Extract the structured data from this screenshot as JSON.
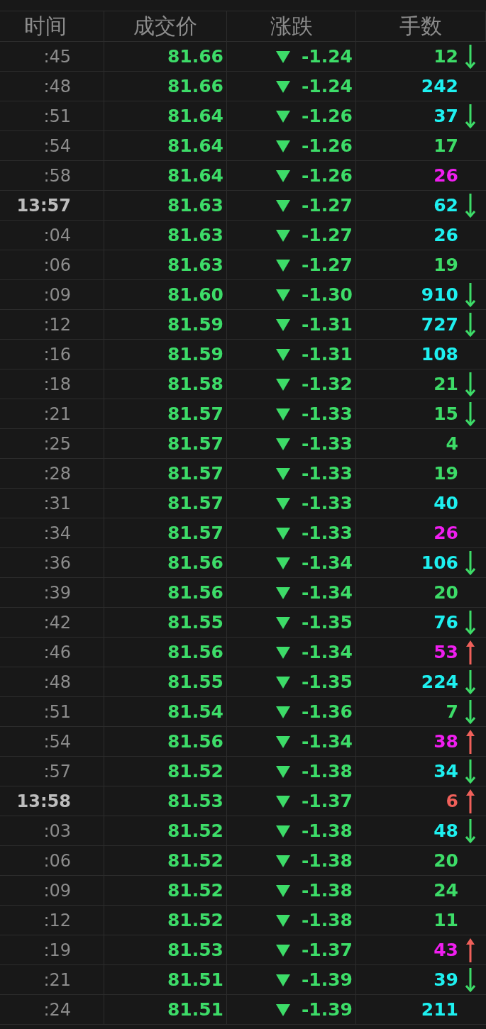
{
  "columns": [
    "时间",
    "成交价",
    "涨跌",
    "手数"
  ],
  "rows": [
    {
      "time": ":45",
      "bold": false,
      "price": "81.66",
      "falling": true,
      "change": "-1.24",
      "volume": "12",
      "color": "#3ddc68",
      "arrow_down": true,
      "arrow_up": false
    },
    {
      "time": ":48",
      "bold": false,
      "price": "81.66",
      "falling": true,
      "change": "-1.24",
      "volume": "242",
      "color": "#1ef0f0",
      "arrow_down": false,
      "arrow_up": false
    },
    {
      "time": ":51",
      "bold": false,
      "price": "81.64",
      "falling": true,
      "change": "-1.26",
      "volume": "37",
      "color": "#1ef0f0",
      "arrow_down": true,
      "arrow_up": false
    },
    {
      "time": ":54",
      "bold": false,
      "price": "81.64",
      "falling": true,
      "change": "-1.26",
      "volume": "17",
      "color": "#3ddc68",
      "arrow_down": false,
      "arrow_up": false
    },
    {
      "time": ":58",
      "bold": false,
      "price": "81.64",
      "falling": true,
      "change": "-1.26",
      "volume": "26",
      "color": "#f01ef0",
      "arrow_down": false,
      "arrow_up": false
    },
    {
      "time": "13:57",
      "bold": true,
      "price": "81.63",
      "falling": true,
      "change": "-1.27",
      "volume": "62",
      "color": "#1ef0f0",
      "arrow_down": true,
      "arrow_up": false
    },
    {
      "time": ":04",
      "bold": false,
      "price": "81.63",
      "falling": true,
      "change": "-1.27",
      "volume": "26",
      "color": "#1ef0f0",
      "arrow_down": false,
      "arrow_up": false
    },
    {
      "time": ":06",
      "bold": false,
      "price": "81.63",
      "falling": true,
      "change": "-1.27",
      "volume": "19",
      "color": "#3ddc68",
      "arrow_down": false,
      "arrow_up": false
    },
    {
      "time": ":09",
      "bold": false,
      "price": "81.60",
      "falling": true,
      "change": "-1.30",
      "volume": "910",
      "color": "#1ef0f0",
      "arrow_down": true,
      "arrow_up": false
    },
    {
      "time": ":12",
      "bold": false,
      "price": "81.59",
      "falling": true,
      "change": "-1.31",
      "volume": "727",
      "color": "#1ef0f0",
      "arrow_down": true,
      "arrow_up": false
    },
    {
      "time": ":16",
      "bold": false,
      "price": "81.59",
      "falling": true,
      "change": "-1.31",
      "volume": "108",
      "color": "#1ef0f0",
      "arrow_down": false,
      "arrow_up": false
    },
    {
      "time": ":18",
      "bold": false,
      "price": "81.58",
      "falling": true,
      "change": "-1.32",
      "volume": "21",
      "color": "#3ddc68",
      "arrow_down": true,
      "arrow_up": false
    },
    {
      "time": ":21",
      "bold": false,
      "price": "81.57",
      "falling": true,
      "change": "-1.33",
      "volume": "15",
      "color": "#3ddc68",
      "arrow_down": true,
      "arrow_up": false
    },
    {
      "time": ":25",
      "bold": false,
      "price": "81.57",
      "falling": true,
      "change": "-1.33",
      "volume": "4",
      "color": "#3ddc68",
      "arrow_down": false,
      "arrow_up": false
    },
    {
      "time": ":28",
      "bold": false,
      "price": "81.57",
      "falling": true,
      "change": "-1.33",
      "volume": "19",
      "color": "#3ddc68",
      "arrow_down": false,
      "arrow_up": false
    },
    {
      "time": ":31",
      "bold": false,
      "price": "81.57",
      "falling": true,
      "change": "-1.33",
      "volume": "40",
      "color": "#1ef0f0",
      "arrow_down": false,
      "arrow_up": false
    },
    {
      "time": ":34",
      "bold": false,
      "price": "81.57",
      "falling": true,
      "change": "-1.33",
      "volume": "26",
      "color": "#f01ef0",
      "arrow_down": false,
      "arrow_up": false
    },
    {
      "time": ":36",
      "bold": false,
      "price": "81.56",
      "falling": true,
      "change": "-1.34",
      "volume": "106",
      "color": "#1ef0f0",
      "arrow_down": true,
      "arrow_up": false
    },
    {
      "time": ":39",
      "bold": false,
      "price": "81.56",
      "falling": true,
      "change": "-1.34",
      "volume": "20",
      "color": "#3ddc68",
      "arrow_down": false,
      "arrow_up": false
    },
    {
      "time": ":42",
      "bold": false,
      "price": "81.55",
      "falling": true,
      "change": "-1.35",
      "volume": "76",
      "color": "#1ef0f0",
      "arrow_down": true,
      "arrow_up": false
    },
    {
      "time": ":46",
      "bold": false,
      "price": "81.56",
      "falling": true,
      "change": "-1.34",
      "volume": "53",
      "color": "#f01ef0",
      "arrow_down": false,
      "arrow_up": true
    },
    {
      "time": ":48",
      "bold": false,
      "price": "81.55",
      "falling": true,
      "change": "-1.35",
      "volume": "224",
      "color": "#1ef0f0",
      "arrow_down": true,
      "arrow_up": false
    },
    {
      "time": ":51",
      "bold": false,
      "price": "81.54",
      "falling": true,
      "change": "-1.36",
      "volume": "7",
      "color": "#3ddc68",
      "arrow_down": true,
      "arrow_up": false
    },
    {
      "time": ":54",
      "bold": false,
      "price": "81.56",
      "falling": true,
      "change": "-1.34",
      "volume": "38",
      "color": "#f01ef0",
      "arrow_down": false,
      "arrow_up": true
    },
    {
      "time": ":57",
      "bold": false,
      "price": "81.52",
      "falling": true,
      "change": "-1.38",
      "volume": "34",
      "color": "#1ef0f0",
      "arrow_down": true,
      "arrow_up": false
    },
    {
      "time": "13:58",
      "bold": true,
      "price": "81.53",
      "falling": true,
      "change": "-1.37",
      "volume": "6",
      "color": "#f0605a",
      "arrow_down": false,
      "arrow_up": true
    },
    {
      "time": ":03",
      "bold": false,
      "price": "81.52",
      "falling": true,
      "change": "-1.38",
      "volume": "48",
      "color": "#1ef0f0",
      "arrow_down": true,
      "arrow_up": false
    },
    {
      "time": ":06",
      "bold": false,
      "price": "81.52",
      "falling": true,
      "change": "-1.38",
      "volume": "20",
      "color": "#3ddc68",
      "arrow_down": false,
      "arrow_up": false
    },
    {
      "time": ":09",
      "bold": false,
      "price": "81.52",
      "falling": true,
      "change": "-1.38",
      "volume": "24",
      "color": "#3ddc68",
      "arrow_down": false,
      "arrow_up": false
    },
    {
      "time": ":12",
      "bold": false,
      "price": "81.52",
      "falling": true,
      "change": "-1.38",
      "volume": "11",
      "color": "#3ddc68",
      "arrow_down": false,
      "arrow_up": false
    },
    {
      "time": ":19",
      "bold": false,
      "price": "81.53",
      "falling": true,
      "change": "-1.37",
      "volume": "43",
      "color": "#f01ef0",
      "arrow_down": false,
      "arrow_up": true
    },
    {
      "time": ":21",
      "bold": false,
      "price": "81.51",
      "falling": true,
      "change": "-1.39",
      "volume": "39",
      "color": "#1ef0f0",
      "arrow_down": true,
      "arrow_up": false
    },
    {
      "time": ":24",
      "bold": false,
      "price": "81.51",
      "falling": true,
      "change": "-1.39",
      "volume": "211",
      "color": "#1ef0f0",
      "arrow_down": false,
      "arrow_up": false
    }
  ]
}
